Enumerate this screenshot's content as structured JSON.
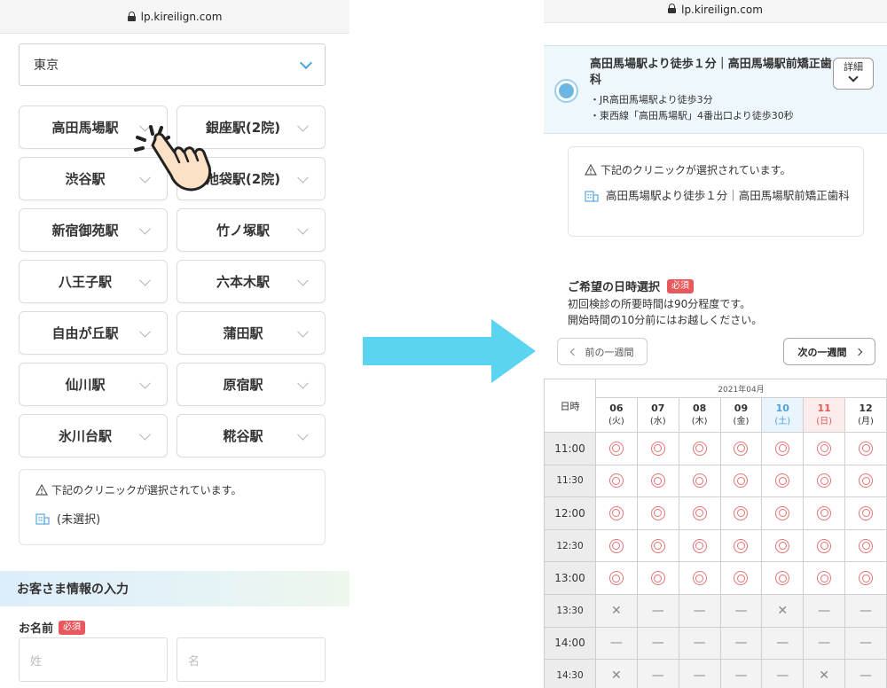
{
  "left": {
    "url": "lp.kireilign.com",
    "prefecture": "東京",
    "stations": [
      "高田馬場駅",
      "銀座駅(2院)",
      "渋谷駅",
      "池袋駅(2院)",
      "新宿御苑駅",
      "竹ノ塚駅",
      "八王子駅",
      "六本木駅",
      "自由が丘駅",
      "蒲田駅",
      "仙川駅",
      "原宿駅",
      "氷川台駅",
      "糀谷駅"
    ],
    "notice": "下記のクリニックが選択されています。",
    "clinic": "(未選択)",
    "section_title": "お客さま情報の入力",
    "name_label": "お名前",
    "required": "必須",
    "last_name_placeholder": "姓",
    "first_name_placeholder": "名"
  },
  "right": {
    "url": "lp.kireilign.com",
    "selected_title": "高田馬場駅より徒歩１分｜高田馬場駅前矯正歯科",
    "access": [
      "・JR高田馬場駅より徒歩3分",
      "・東西線「高田馬場駅」4番出口より徒歩30秒"
    ],
    "detail_label": "詳細",
    "notice": "下記のクリニックが選択されています。",
    "clinic": "高田馬場駅より徒歩１分｜高田馬場駅前矯正歯科",
    "datetime_title": "ご希望の日時選択",
    "required": "必須",
    "desc1": "初回検診の所要時間は90分程度です。",
    "desc2": "開始時間の10分前にはお越しください。",
    "prev_week": "前の一週間",
    "next_week": "次の一週間",
    "month": "2021年04月",
    "time_header": "日時",
    "days": [
      {
        "num": "06",
        "dow": "(火)",
        "kind": "weekday"
      },
      {
        "num": "07",
        "dow": "(水)",
        "kind": "weekday"
      },
      {
        "num": "08",
        "dow": "(木)",
        "kind": "weekday"
      },
      {
        "num": "09",
        "dow": "(金)",
        "kind": "weekday"
      },
      {
        "num": "10",
        "dow": "(土)",
        "kind": "sat"
      },
      {
        "num": "11",
        "dow": "(日)",
        "kind": "sun"
      },
      {
        "num": "12",
        "dow": "(月)",
        "kind": "weekday"
      }
    ],
    "slots": [
      {
        "time": "11:00",
        "cells": [
          "o",
          "o",
          "o",
          "o",
          "o",
          "o",
          "o"
        ]
      },
      {
        "time": "11:30",
        "cells": [
          "o",
          "o",
          "o",
          "o",
          "o",
          "o",
          "o"
        ]
      },
      {
        "time": "12:00",
        "cells": [
          "o",
          "o",
          "o",
          "o",
          "o",
          "o",
          "o"
        ]
      },
      {
        "time": "12:30",
        "cells": [
          "o",
          "o",
          "o",
          "o",
          "o",
          "o",
          "o"
        ]
      },
      {
        "time": "13:00",
        "cells": [
          "o",
          "o",
          "o",
          "o",
          "o",
          "o",
          "o"
        ]
      },
      {
        "time": "13:30",
        "cells": [
          "x",
          "-",
          "-",
          "-",
          "x",
          "-",
          "-"
        ]
      },
      {
        "time": "14:00",
        "cells": [
          "-",
          "-",
          "-",
          "-",
          "-",
          "-",
          "-"
        ]
      },
      {
        "time": "14:30",
        "cells": [
          "x",
          "-",
          "-",
          "-",
          "-",
          "x",
          "-"
        ]
      }
    ],
    "symbols": {
      "x": "✕",
      "-": "—"
    }
  },
  "colors": {
    "accent": "#4aa3df",
    "arrow": "#5bd4f2",
    "required": "#e8595d",
    "available": "#e27474"
  }
}
